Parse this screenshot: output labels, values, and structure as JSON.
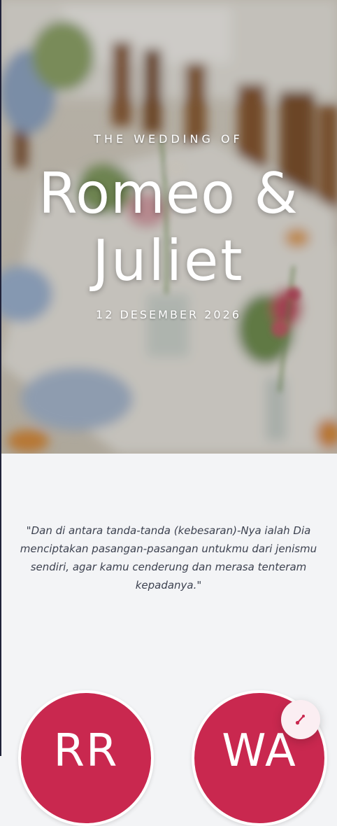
{
  "hero": {
    "eyebrow": "THE WEDDING OF",
    "couple_line_1": "Romeo &",
    "couple_line_2": "Juliet",
    "date": "12 DESEMBER 2026"
  },
  "quote": {
    "text": "\"Dan di antara tanda-tanda (kebesaran)-Nya ialah Dia menciptakan pasangan-pasangan untukmu dari jenismu sendiri, agar kamu cenderung dan merasa tenteram kepadanya.\""
  },
  "couple": {
    "groom_initials": "RR",
    "bride_initials": "WA"
  },
  "music_button": {
    "icon": "music-note-icon"
  },
  "colors": {
    "accent": "#c9284f",
    "page_background": "#f3f4f6",
    "music_button_bg": "#fbeef2"
  }
}
